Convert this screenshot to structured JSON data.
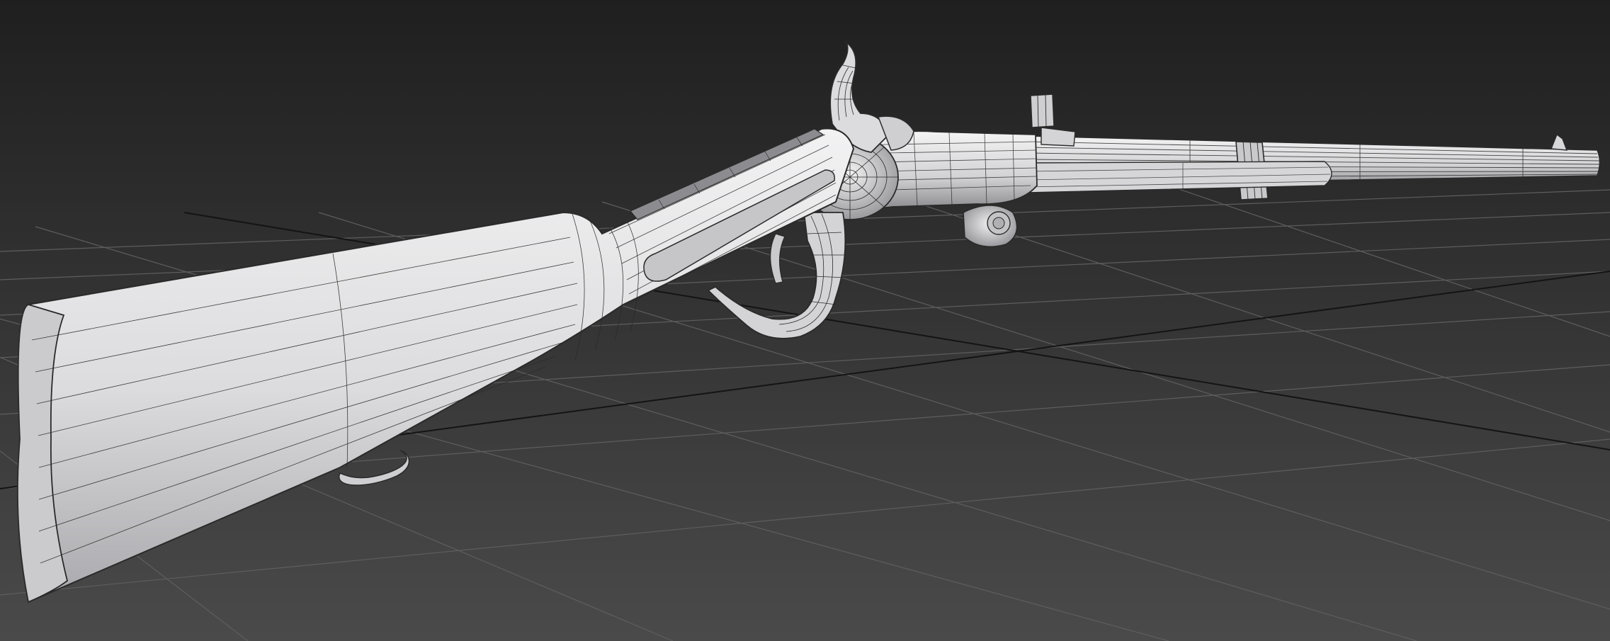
{
  "viewport": {
    "background_top": "#1f1f1f",
    "background_bottom": "#4a4a4a",
    "grid_color": "#5e5e5e",
    "grid_axis_color": "#141414",
    "mesh_fill": "#d8d8da",
    "mesh_fill_light": "#eeeeef",
    "mesh_fill_shadow": "#9c9ca0",
    "wire_color": "#2a2a2a"
  },
  "scene": {
    "model_icon": "rifle-wireframe-model"
  }
}
